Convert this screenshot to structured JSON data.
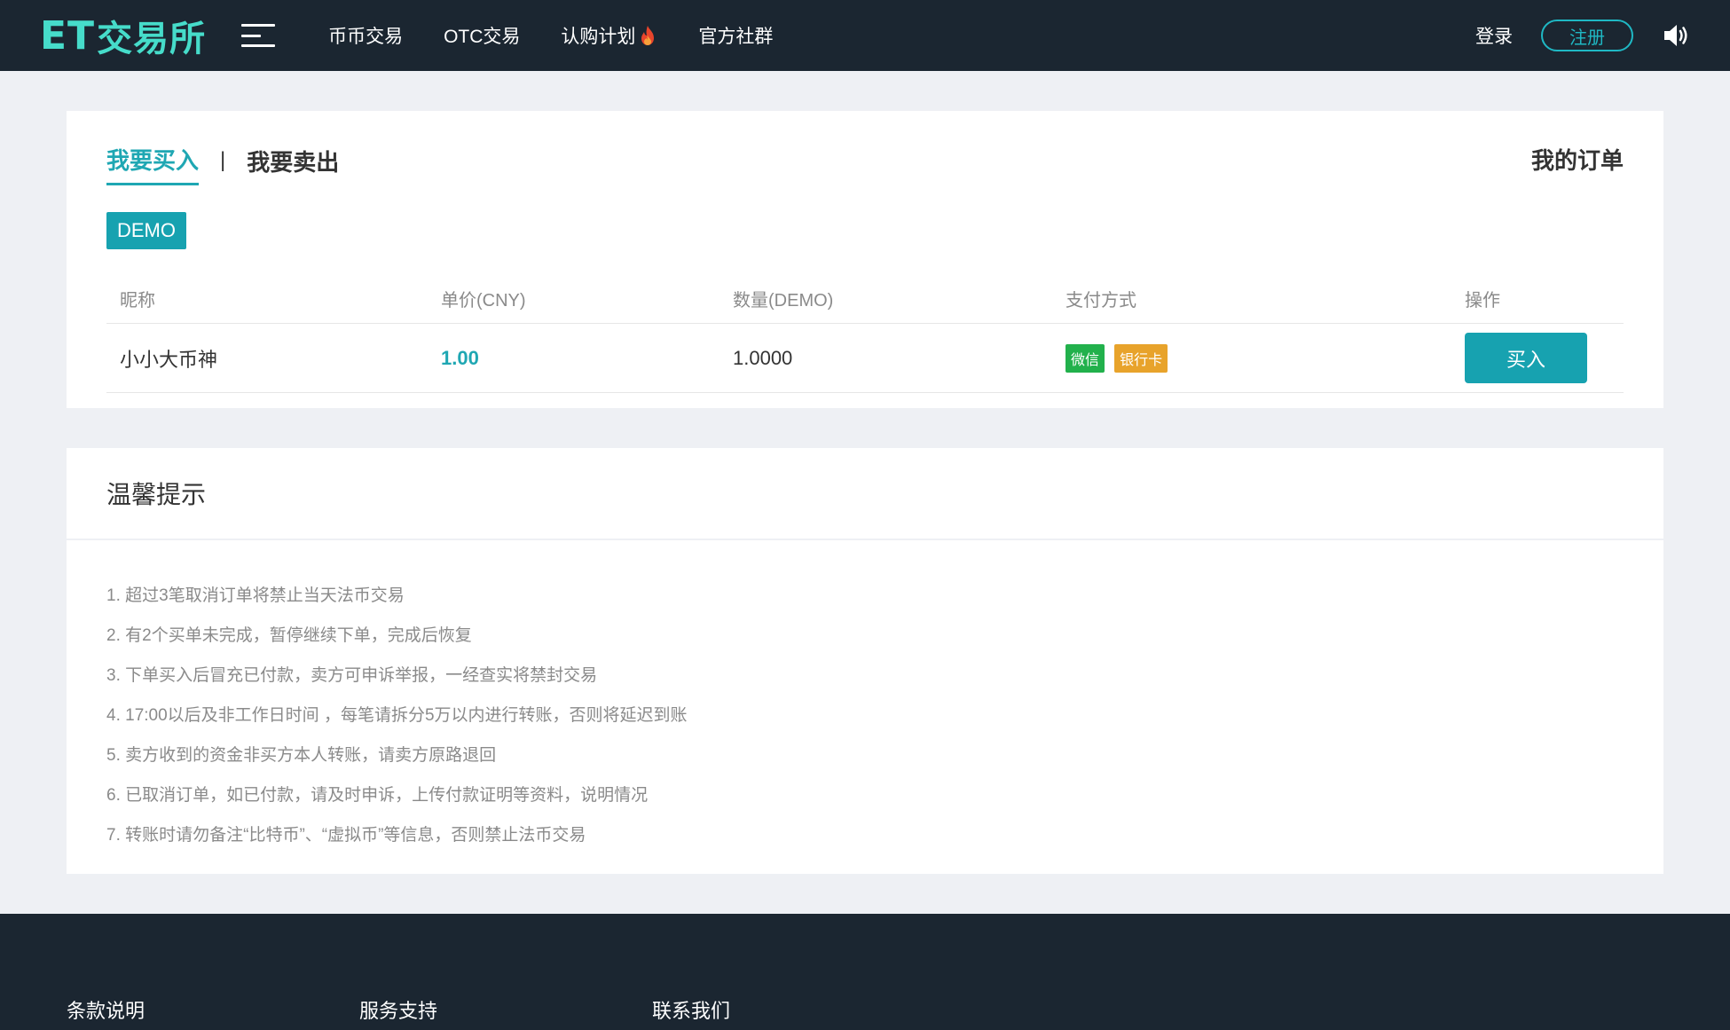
{
  "header": {
    "logo_et": "ET",
    "logo_text": "交易所",
    "nav": [
      "币币交易",
      "OTC交易",
      "认购计划",
      "官方社群"
    ],
    "login": "登录",
    "register": "注册"
  },
  "trade": {
    "tab_buy": "我要买入",
    "tab_sep": "|",
    "tab_sell": "我要卖出",
    "my_orders": "我的订单",
    "coin": "DEMO",
    "columns": [
      "昵称",
      "单价(CNY)",
      "数量(DEMO)",
      "支付方式",
      "操作"
    ],
    "rows": [
      {
        "nickname": "小小大币神",
        "price": "1.00",
        "quantity": "1.0000",
        "payments": [
          "微信",
          "银行卡"
        ],
        "action": "买入"
      }
    ]
  },
  "tips": {
    "title": "温馨提示",
    "items": [
      "1. 超过3笔取消订单将禁止当天法币交易",
      "2. 有2个买单未完成，暂停继续下单，完成后恢复",
      "3. 下单买入后冒充已付款，卖方可申诉举报，一经查实将禁封交易",
      "4. 17:00以后及非工作日时间 ，每笔请拆分5万以内进行转账，否则将延迟到账",
      "5. 卖方收到的资金非买方本人转账，请卖方原路退回",
      "6. 已取消订单，如已付款，请及时申诉，上传付款证明等资料，说明情况",
      "7. 转账时请勿备注“比特币”、“虚拟币”等信息，否则禁止法币交易"
    ]
  },
  "footer": {
    "cols": [
      "条款说明",
      "服务支持",
      "联系我们"
    ]
  },
  "colors": {
    "header_bg": "#1b2631",
    "accent": "#17a2b0",
    "logo": "#46dcca",
    "wechat": "#22b14c",
    "bank": "#e8a32b"
  },
  "icons": [
    "menu-icon",
    "fire-icon",
    "speaker-icon"
  ]
}
